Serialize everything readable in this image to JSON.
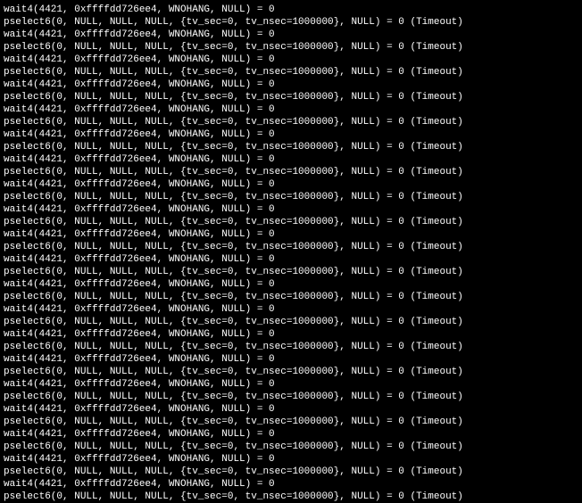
{
  "wait_pid": "4421",
  "wait_addr": "0xffffdd726ee4",
  "wait_flag": "WNOHANG",
  "wait_arg4": "NULL",
  "wait_ret": "0",
  "psel_nfds": "0",
  "psel_readfds": "NULL",
  "psel_writefds": "NULL",
  "psel_exceptfds": "NULL",
  "psel_tv_sec": "0",
  "psel_tv_nsec": "1000000",
  "psel_sigmask": "NULL",
  "psel_ret": "0",
  "psel_note": "Timeout",
  "line_count": 40,
  "first_is_wait": true
}
